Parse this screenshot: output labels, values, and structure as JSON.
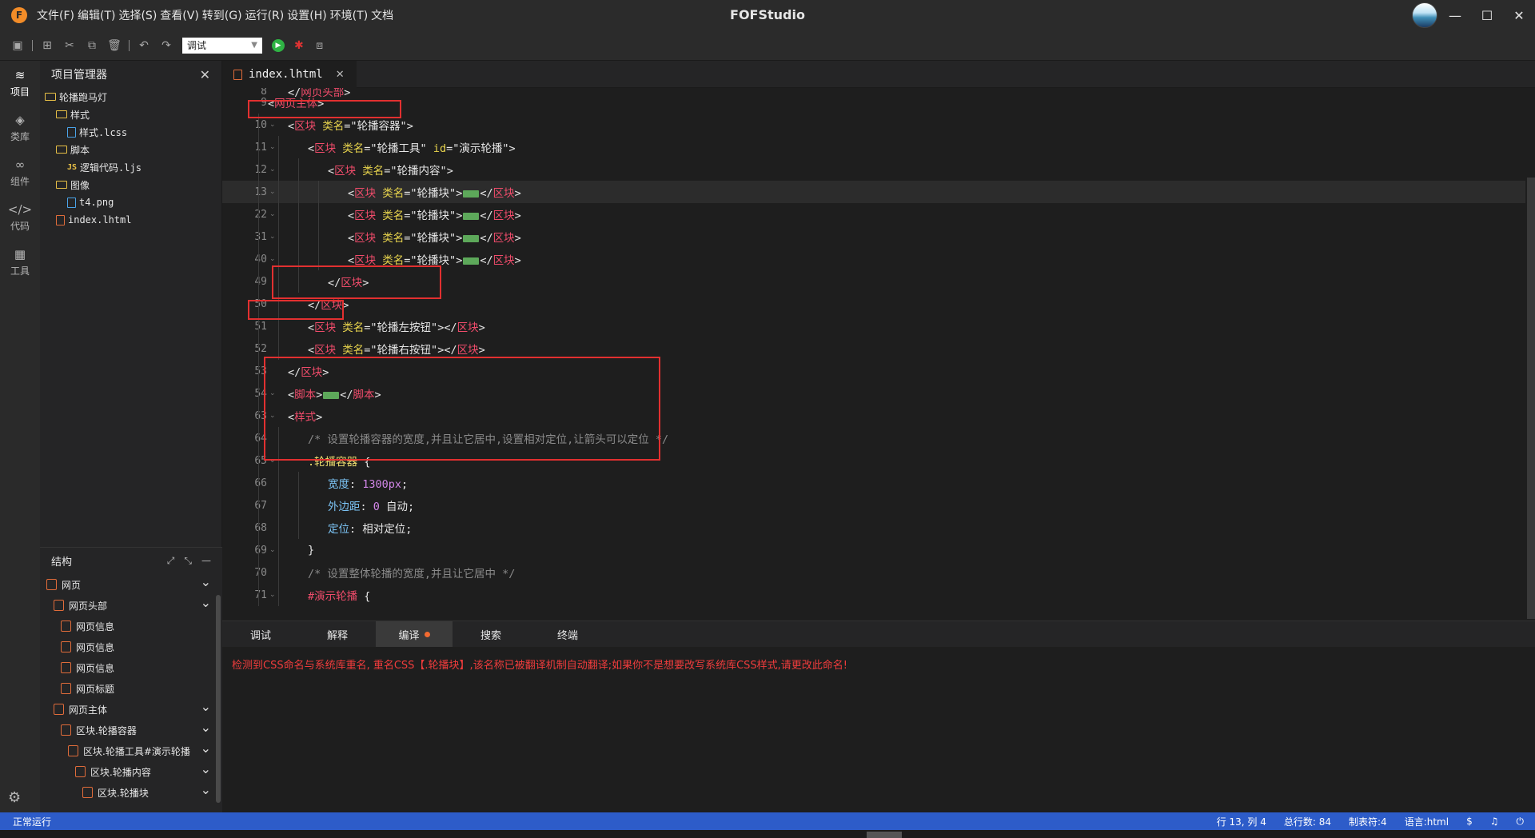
{
  "app": {
    "title": "FOFStudio",
    "logo_letter": "F",
    "menus": [
      "文件(F)",
      "编辑(T)",
      "选择(S)",
      "查看(V)",
      "转到(G)",
      "运行(R)",
      "设置(H)",
      "环境(T)",
      "文档"
    ],
    "window_controls": {
      "minimize": "—",
      "maximize": "☐",
      "close": "✕"
    }
  },
  "toolbar": {
    "run_mode": "调试"
  },
  "activity": [
    {
      "label": "项目",
      "icon": "layers-icon",
      "glyph": "≋"
    },
    {
      "label": "类库",
      "icon": "cube-icon",
      "glyph": "◈"
    },
    {
      "label": "组件",
      "icon": "link-icon",
      "glyph": "∞"
    },
    {
      "label": "代码",
      "icon": "code-icon",
      "glyph": "</>"
    },
    {
      "label": "工具",
      "icon": "grid-icon",
      "glyph": "▦"
    }
  ],
  "explorer": {
    "title": "项目管理器",
    "tree": [
      {
        "name": "轮播跑马灯",
        "type": "folder",
        "level": 0
      },
      {
        "name": "样式",
        "type": "folder",
        "level": 1
      },
      {
        "name": "样式.lcss",
        "type": "file-css",
        "level": 2
      },
      {
        "name": "脚本",
        "type": "folder",
        "level": 1
      },
      {
        "name": "逻辑代码.ljs",
        "type": "file-js",
        "level": 2
      },
      {
        "name": "图像",
        "type": "folder",
        "level": 1
      },
      {
        "name": "t4.png",
        "type": "file-img",
        "level": 2
      },
      {
        "name": "index.lhtml",
        "type": "file-html",
        "level": 1
      }
    ]
  },
  "structure": {
    "title": "结构",
    "rows": [
      {
        "label": "网页",
        "level": 0,
        "chevron": true
      },
      {
        "label": "网页头部",
        "level": 1,
        "chevron": true
      },
      {
        "label": "网页信息",
        "level": 2,
        "chevron": false
      },
      {
        "label": "网页信息",
        "level": 2,
        "chevron": false
      },
      {
        "label": "网页信息",
        "level": 2,
        "chevron": false
      },
      {
        "label": "网页标题",
        "level": 2,
        "chevron": false
      },
      {
        "label": "网页主体",
        "level": 1,
        "chevron": true
      },
      {
        "label": "区块.轮播容器",
        "level": 2,
        "chevron": true
      },
      {
        "label": "区块.轮播工具#演示轮播",
        "level": 3,
        "chevron": true
      },
      {
        "label": "区块.轮播内容",
        "level": 4,
        "chevron": true
      },
      {
        "label": "区块.轮播块",
        "level": 5,
        "chevron": true
      }
    ]
  },
  "editor": {
    "tab": "index.lhtml",
    "lines": [
      {
        "n": "9",
        "fold": true,
        "indent": 1,
        "tokens": [
          [
            "t-br",
            "<"
          ],
          [
            "t-tag",
            "网页主体"
          ],
          [
            "t-br",
            ">"
          ]
        ]
      },
      {
        "n": "10",
        "fold": true,
        "indent": 2,
        "tokens": [
          [
            "t-br",
            "<"
          ],
          [
            "t-tag",
            "区块 "
          ],
          [
            "t-attr",
            "类名"
          ],
          [
            "t-br",
            "="
          ],
          [
            "t-val",
            "\"轮播容器\""
          ],
          [
            "t-br",
            ">"
          ]
        ]
      },
      {
        "n": "11",
        "fold": true,
        "indent": 3,
        "tokens": [
          [
            "t-br",
            "<"
          ],
          [
            "t-tag",
            "区块 "
          ],
          [
            "t-attr",
            "类名"
          ],
          [
            "t-br",
            "="
          ],
          [
            "t-val",
            "\"轮播工具\" "
          ],
          [
            "t-attr",
            "id"
          ],
          [
            "t-br",
            "="
          ],
          [
            "t-val",
            "\"演示轮播\""
          ],
          [
            "t-br",
            ">"
          ]
        ]
      },
      {
        "n": "12",
        "fold": true,
        "indent": 4,
        "tokens": [
          [
            "t-br",
            "<"
          ],
          [
            "t-tag",
            "区块 "
          ],
          [
            "t-attr",
            "类名"
          ],
          [
            "t-br",
            "="
          ],
          [
            "t-val",
            "\"轮播内容\""
          ],
          [
            "t-br",
            ">"
          ]
        ]
      },
      {
        "n": "13",
        "fold": true,
        "indent": 5,
        "current": true,
        "tokens": [
          [
            "t-br",
            "<"
          ],
          [
            "t-tag",
            "区块 "
          ],
          [
            "t-attr",
            "类名"
          ],
          [
            "t-br",
            "="
          ],
          [
            "t-val",
            "\"轮播块\""
          ],
          [
            "t-br",
            ">"
          ],
          [
            "fold",
            ""
          ],
          [
            "t-br",
            "</"
          ],
          [
            "t-tag",
            "区块"
          ],
          [
            "t-br",
            ">"
          ]
        ]
      },
      {
        "n": "22",
        "fold": true,
        "indent": 5,
        "tokens": [
          [
            "t-br",
            "<"
          ],
          [
            "t-tag",
            "区块 "
          ],
          [
            "t-attr",
            "类名"
          ],
          [
            "t-br",
            "="
          ],
          [
            "t-val",
            "\"轮播块\""
          ],
          [
            "t-br",
            ">"
          ],
          [
            "fold",
            ""
          ],
          [
            "t-br",
            "</"
          ],
          [
            "t-tag",
            "区块"
          ],
          [
            "t-br",
            ">"
          ]
        ]
      },
      {
        "n": "31",
        "fold": true,
        "indent": 5,
        "tokens": [
          [
            "t-br",
            "<"
          ],
          [
            "t-tag",
            "区块 "
          ],
          [
            "t-attr",
            "类名"
          ],
          [
            "t-br",
            "="
          ],
          [
            "t-val",
            "\"轮播块\""
          ],
          [
            "t-br",
            ">"
          ],
          [
            "fold",
            ""
          ],
          [
            "t-br",
            "</"
          ],
          [
            "t-tag",
            "区块"
          ],
          [
            "t-br",
            ">"
          ]
        ]
      },
      {
        "n": "40",
        "fold": true,
        "indent": 5,
        "tokens": [
          [
            "t-br",
            "<"
          ],
          [
            "t-tag",
            "区块 "
          ],
          [
            "t-attr",
            "类名"
          ],
          [
            "t-br",
            "="
          ],
          [
            "t-val",
            "\"轮播块\""
          ],
          [
            "t-br",
            ">"
          ],
          [
            "fold",
            ""
          ],
          [
            "t-br",
            "</"
          ],
          [
            "t-tag",
            "区块"
          ],
          [
            "t-br",
            ">"
          ]
        ]
      },
      {
        "n": "49",
        "fold": false,
        "indent": 4,
        "tokens": [
          [
            "t-br",
            "</"
          ],
          [
            "t-tag",
            "区块"
          ],
          [
            "t-br",
            ">"
          ]
        ]
      },
      {
        "n": "50",
        "fold": false,
        "indent": 3,
        "tokens": [
          [
            "t-br",
            "</"
          ],
          [
            "t-tag",
            "区块"
          ],
          [
            "t-br",
            ">"
          ]
        ]
      },
      {
        "n": "51",
        "fold": false,
        "indent": 3,
        "tokens": [
          [
            "t-br",
            "<"
          ],
          [
            "t-tag",
            "区块 "
          ],
          [
            "t-attr",
            "类名"
          ],
          [
            "t-br",
            "="
          ],
          [
            "t-val",
            "\"轮播左按钮\""
          ],
          [
            "t-br",
            "></"
          ],
          [
            "t-tag",
            "区块"
          ],
          [
            "t-br",
            ">"
          ]
        ]
      },
      {
        "n": "52",
        "fold": false,
        "indent": 3,
        "tokens": [
          [
            "t-br",
            "<"
          ],
          [
            "t-tag",
            "区块 "
          ],
          [
            "t-attr",
            "类名"
          ],
          [
            "t-br",
            "="
          ],
          [
            "t-val",
            "\"轮播右按钮\""
          ],
          [
            "t-br",
            "></"
          ],
          [
            "t-tag",
            "区块"
          ],
          [
            "t-br",
            ">"
          ]
        ]
      },
      {
        "n": "53",
        "fold": false,
        "indent": 2,
        "tokens": [
          [
            "t-br",
            "</"
          ],
          [
            "t-tag",
            "区块"
          ],
          [
            "t-br",
            ">"
          ]
        ]
      },
      {
        "n": "54",
        "fold": true,
        "indent": 2,
        "tokens": [
          [
            "t-br",
            "<"
          ],
          [
            "t-tag",
            "脚本"
          ],
          [
            "t-br",
            ">"
          ],
          [
            "fold",
            ""
          ],
          [
            "t-br",
            "</"
          ],
          [
            "t-tag",
            "脚本"
          ],
          [
            "t-br",
            ">"
          ]
        ]
      },
      {
        "n": "63",
        "fold": true,
        "indent": 2,
        "tokens": [
          [
            "t-br",
            "<"
          ],
          [
            "t-tag",
            "样式"
          ],
          [
            "t-br",
            ">"
          ]
        ]
      },
      {
        "n": "64",
        "fold": false,
        "indent": 3,
        "tokens": [
          [
            "t-cmt",
            "/* 设置轮播容器的宽度,并且让它居中,设置相对定位,让箭头可以定位 */"
          ]
        ]
      },
      {
        "n": "65",
        "fold": true,
        "indent": 3,
        "tokens": [
          [
            "t-sel",
            ".轮播容器 "
          ],
          [
            "t-br",
            "{"
          ]
        ]
      },
      {
        "n": "66",
        "fold": false,
        "indent": 4,
        "tokens": [
          [
            "t-prop",
            "宽度"
          ],
          [
            "t-br",
            ": "
          ],
          [
            "t-num",
            "1300px"
          ],
          [
            "t-br",
            ";"
          ]
        ]
      },
      {
        "n": "67",
        "fold": false,
        "indent": 4,
        "tokens": [
          [
            "t-prop",
            "外边距"
          ],
          [
            "t-br",
            ": "
          ],
          [
            "t-num",
            "0"
          ],
          [
            "t-br",
            " 自动;"
          ]
        ]
      },
      {
        "n": "68",
        "fold": false,
        "indent": 4,
        "tokens": [
          [
            "t-prop",
            "定位"
          ],
          [
            "t-br",
            ": 相对定位;"
          ]
        ]
      },
      {
        "n": "69",
        "fold": true,
        "indent": 3,
        "tokens": [
          [
            "t-br",
            "}"
          ]
        ]
      },
      {
        "n": "70",
        "fold": false,
        "indent": 3,
        "tokens": [
          [
            "t-cmt",
            "/* 设置整体轮播的宽度,并且让它居中 */"
          ]
        ]
      },
      {
        "n": "71",
        "fold": true,
        "indent": 3,
        "tokens": [
          [
            "t-id",
            "#演示轮播 "
          ],
          [
            "t-br",
            "{"
          ]
        ]
      }
    ]
  },
  "bottom_panel": {
    "tabs": [
      "调试",
      "解释",
      "编译",
      "搜索",
      "终端"
    ],
    "active_tab": "编译",
    "message": "检测到CSS命名与系统库重名, 重名CSS【.轮播块】,该名称已被翻译机制自动翻译;如果你不是想要改写系统库CSS样式,请更改此命名!"
  },
  "status": {
    "run_state": "正常运行",
    "cursor": "行 13, 列 4",
    "total_lines": "总行数: 84",
    "tab_size": "制表符:4",
    "language": "语言:html"
  }
}
